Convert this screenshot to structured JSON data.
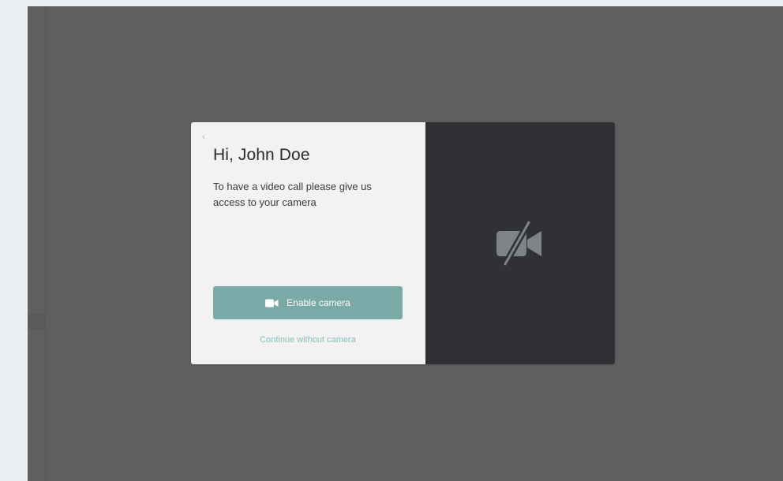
{
  "modal": {
    "back_glyph": "‹",
    "title": "Hi, John Doe",
    "description": "To have a video call please give us access to your camera",
    "enable_button_label": "Enable camera",
    "continue_link_label": "Continue without camera"
  },
  "icons": {
    "back": "chevron-left-icon",
    "enable_button": "video-camera-icon",
    "preview": "video-camera-off-icon"
  },
  "colors": {
    "background": "#e9eef2",
    "overlay": "#5f5f5f",
    "modal_left_bg": "#f2f2f2",
    "modal_right_bg": "#2f3134",
    "accent_button": "#7aaaa7",
    "accent_link": "#86bfbb",
    "camera_off_icon": "#7f8387"
  }
}
